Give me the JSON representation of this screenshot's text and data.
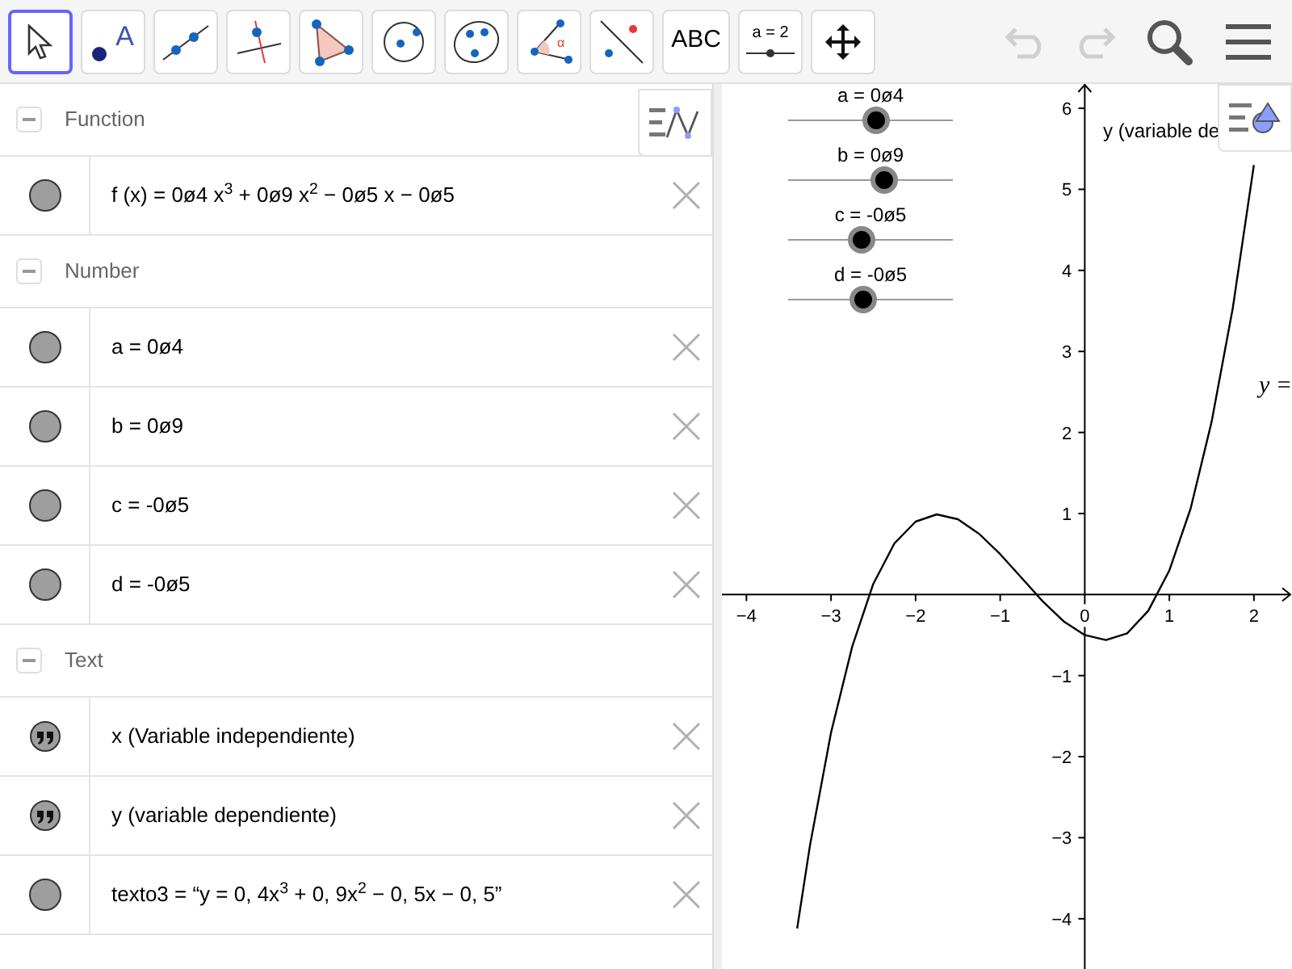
{
  "toolbar": {
    "tools": [
      {
        "kind": "move",
        "selected": true
      },
      {
        "kind": "point",
        "selected": false,
        "label": "A"
      },
      {
        "kind": "line",
        "selected": false
      },
      {
        "kind": "perpendicular",
        "selected": false
      },
      {
        "kind": "polygon",
        "selected": false
      },
      {
        "kind": "circle",
        "selected": false
      },
      {
        "kind": "conic",
        "selected": false
      },
      {
        "kind": "angle",
        "selected": false,
        "label": "α"
      },
      {
        "kind": "reflect",
        "selected": false
      },
      {
        "kind": "text",
        "selected": false,
        "label": "ABC"
      },
      {
        "kind": "slider",
        "selected": false,
        "label": "a = 2"
      },
      {
        "kind": "move_view",
        "selected": false
      }
    ],
    "undo": {
      "disabled": true
    },
    "redo": {
      "disabled": true
    }
  },
  "algebra": {
    "groups": [
      {
        "title": "Function",
        "expanded": true,
        "items": [
          {
            "kind": "value",
            "visible": true,
            "text": "f (x) = 0ø4 x$^{3}$ + 0ø9 x$^{2}$ − 0ø5 x − 0ø5"
          }
        ]
      },
      {
        "title": "Number",
        "expanded": true,
        "items": [
          {
            "kind": "value",
            "visible": true,
            "text": "a = 0ø4"
          },
          {
            "kind": "value",
            "visible": true,
            "text": "b = 0ø9"
          },
          {
            "kind": "value",
            "visible": true,
            "text": "c = -0ø5"
          },
          {
            "kind": "value",
            "visible": true,
            "text": "d = -0ø5"
          }
        ]
      },
      {
        "title": "Text",
        "expanded": true,
        "items": [
          {
            "kind": "text",
            "visible": true,
            "text": "x (Variable independiente)"
          },
          {
            "kind": "text",
            "visible": true,
            "text": "y (variable dependiente)"
          },
          {
            "kind": "value",
            "visible": true,
            "text": "texto3 =  “y = 0, 4x$^{3}$ + 0, 9x$^{2}$ − 0, 5x − 0, 5”"
          }
        ]
      }
    ]
  },
  "graphics": {
    "sliders": [
      {
        "label": "a = 0ø4",
        "level": 0.53
      },
      {
        "label": "b = 0ø9",
        "level": 0.58
      },
      {
        "label": "c = -0ø5",
        "level": 0.44
      },
      {
        "label": "d = -0ø5",
        "level": 0.45
      }
    ],
    "texts": [
      {
        "kind": "plain",
        "text": "y (variable de"
      },
      {
        "kind": "math",
        "text": "y ="
      }
    ],
    "chart_data": {
      "type": "line",
      "xlim": [
        -4.29,
        2.45
      ],
      "ylim": [
        -4.62,
        6.3
      ],
      "xticks": [
        -4,
        -3,
        -2,
        -1,
        0,
        1,
        2
      ],
      "yticks": [
        -4,
        -3,
        -2,
        -1,
        1,
        2,
        3,
        4,
        5,
        6
      ],
      "x": [
        -3.4,
        -3.25,
        -3,
        -2.75,
        -2.5,
        -2.25,
        -2,
        -1.75,
        -1.5,
        -1.25,
        -1,
        -0.75,
        -0.5,
        -0.25,
        0,
        0.25,
        0.5,
        0.75,
        1,
        1.25,
        1.5,
        1.75,
        2
      ],
      "series": [
        {
          "color": "#000000",
          "values": [
            -4.12,
            -3.1,
            -1.7,
            -0.64,
            0.13,
            0.63,
            0.9,
            0.99,
            0.93,
            0.75,
            0.5,
            0.21,
            -0.08,
            -0.33,
            -0.5,
            -0.56,
            -0.48,
            -0.2,
            0.3,
            1.06,
            2.13,
            3.53,
            5.3
          ]
        }
      ]
    }
  }
}
